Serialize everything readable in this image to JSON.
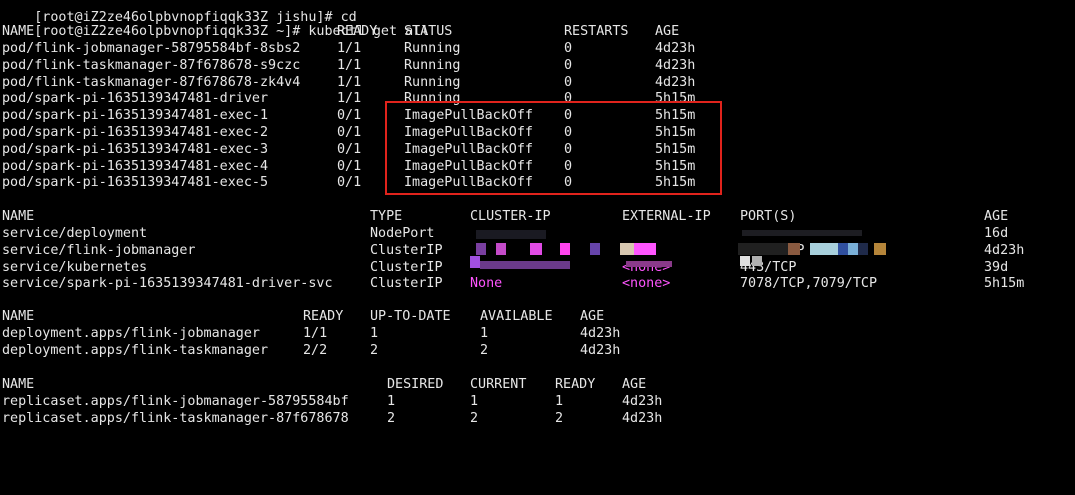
{
  "prompt": {
    "first_line_partial": "[root@iZ2ze46olpbvnopfiqqk33Z jishu]# cd",
    "command_line": "[root@iZ2ze46olpbvnopfiqqk33Z ~]# kubectl get all"
  },
  "colors": {
    "background": "#000000",
    "text": "#e6e6e6",
    "highlight_box": "#e0231c",
    "none_value": "#ff55ff"
  },
  "pods": {
    "headers": [
      "NAME",
      "READY",
      "STATUS",
      "RESTARTS",
      "AGE"
    ],
    "rows": [
      [
        "pod/flink-jobmanager-58795584bf-8sbs2",
        "1/1",
        "Running",
        "0",
        "4d23h"
      ],
      [
        "pod/flink-taskmanager-87f678678-s9czc",
        "1/1",
        "Running",
        "0",
        "4d23h"
      ],
      [
        "pod/flink-taskmanager-87f678678-zk4v4",
        "1/1",
        "Running",
        "0",
        "4d23h"
      ],
      [
        "pod/spark-pi-1635139347481-driver",
        "1/1",
        "Running",
        "0",
        "5h15m"
      ],
      [
        "pod/spark-pi-1635139347481-exec-1",
        "0/1",
        "ImagePullBackOff",
        "0",
        "5h15m"
      ],
      [
        "pod/spark-pi-1635139347481-exec-2",
        "0/1",
        "ImagePullBackOff",
        "0",
        "5h15m"
      ],
      [
        "pod/spark-pi-1635139347481-exec-3",
        "0/1",
        "ImagePullBackOff",
        "0",
        "5h15m"
      ],
      [
        "pod/spark-pi-1635139347481-exec-4",
        "0/1",
        "ImagePullBackOff",
        "0",
        "5h15m"
      ],
      [
        "pod/spark-pi-1635139347481-exec-5",
        "0/1",
        "ImagePullBackOff",
        "0",
        "5h15m"
      ]
    ]
  },
  "services": {
    "headers": [
      "NAME",
      "TYPE",
      "CLUSTER-IP",
      "EXTERNAL-IP",
      "PORT(S)",
      "AGE"
    ],
    "rows": [
      [
        "service/deployment",
        "NodePort",
        "",
        "",
        "",
        "16d"
      ],
      [
        "service/flink-jobmanager",
        "ClusterIP",
        "",
        "",
        "8081/TCP",
        "4d23h"
      ],
      [
        "service/kubernetes",
        "ClusterIP",
        "",
        "<none>",
        "443/TCP",
        "39d"
      ],
      [
        "service/spark-pi-1635139347481-driver-svc",
        "ClusterIP",
        "None",
        "<none>",
        "7078/TCP,7079/TCP",
        "5h15m"
      ]
    ]
  },
  "deployments": {
    "headers": [
      "NAME",
      "READY",
      "UP-TO-DATE",
      "AVAILABLE",
      "AGE"
    ],
    "rows": [
      [
        "deployment.apps/flink-jobmanager",
        "1/1",
        "1",
        "1",
        "4d23h"
      ],
      [
        "deployment.apps/flink-taskmanager",
        "2/2",
        "2",
        "2",
        "4d23h"
      ]
    ]
  },
  "replicasets": {
    "headers": [
      "NAME",
      "DESIRED",
      "CURRENT",
      "READY",
      "AGE"
    ],
    "rows": [
      [
        "replicaset.apps/flink-jobmanager-58795584bf",
        "1",
        "1",
        "1",
        "4d23h"
      ],
      [
        "replicaset.apps/flink-taskmanager-87f678678",
        "2",
        "2",
        "2",
        "4d23h"
      ]
    ]
  }
}
